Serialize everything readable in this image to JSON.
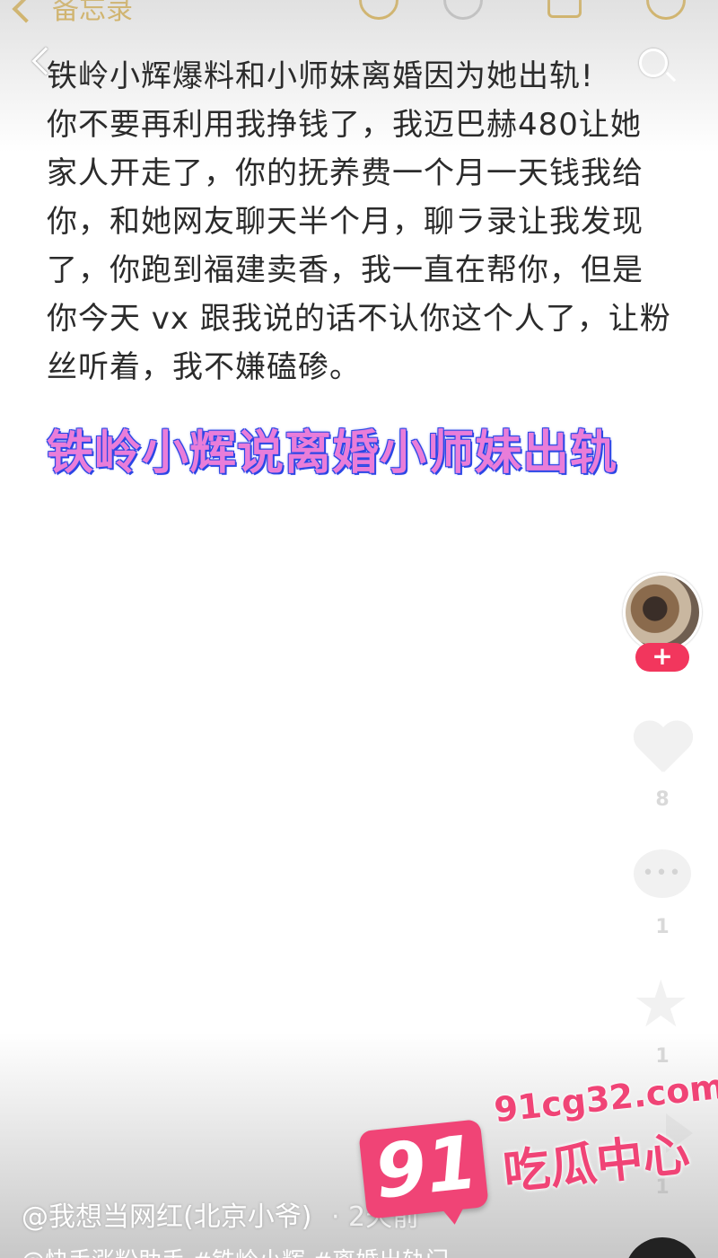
{
  "notes_app": {
    "back_label": "备忘录"
  },
  "note": {
    "lines": [
      "铁岭小辉爆料和小师妹离婚因为她出轨!",
      "你不要再利用我挣钱了，我迈巴赫480让她",
      "家人开走了，你的抚养费一个月一天钱我给",
      "你，和她网友聊天半个月，聊ラ录让我发现",
      "了，你跑到福建卖香，我一直在帮你，但是",
      "你今天 vx 跟我说的话不认你这个人了，让粉",
      "丝听着，我不嫌磕碜。"
    ]
  },
  "video_overlay": {
    "headline": "铁岭小辉说离婚小师妹出轨",
    "author": "@我想当网红(北京小爷)",
    "posted_ago": "· 2天前",
    "caption": "@快手涨粉助手 #铁岭小辉 #离婚出轨门"
  },
  "actions": {
    "follow_symbol": "+",
    "like_count": "8",
    "comment_count": "1",
    "favorite_count": "1",
    "share_count": "1"
  },
  "watermark": {
    "number": "91",
    "domain": "91cg32.com",
    "name": "吃瓜中心"
  },
  "colors": {
    "headline_fill": "#e97dd9",
    "headline_outline": "#2c47e6",
    "follow_button": "#f2365d",
    "watermark": "#f04476",
    "notes_accent": "#d9a21b"
  },
  "icons": [
    "back-icon",
    "search-icon",
    "heart-icon",
    "comment-icon",
    "star-icon",
    "share-icon"
  ]
}
